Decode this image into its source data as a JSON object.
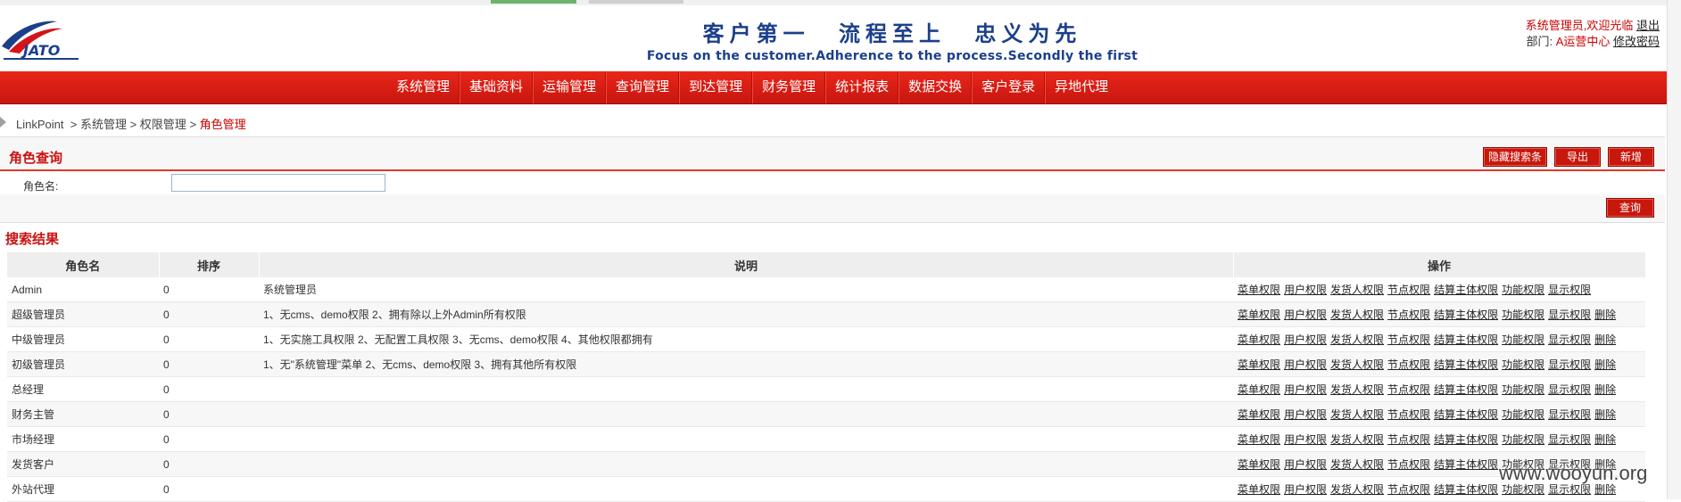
{
  "header": {
    "logo_text": "JATO",
    "slogan_cn": "客户第一   流程至上   忠义为先",
    "slogan_en": "Focus on the customer.Adherence to the process.Secondly the first",
    "user_welcome": "系统管理员,欢迎光临",
    "logout_label": "退出",
    "dept_label": "部门:",
    "dept_value": "A运营中心",
    "change_password_label": "修改密码"
  },
  "nav": {
    "items": [
      "系统管理",
      "基础资料",
      "运输管理",
      "查询管理",
      "到达管理",
      "财务管理",
      "统计报表",
      "数据交换",
      "客户登录",
      "异地代理"
    ]
  },
  "breadcrumb": {
    "root": "LinkPoint",
    "sep": ">",
    "level1": "系统管理",
    "level2": "权限管理",
    "current": "角色管理"
  },
  "search_panel": {
    "title": "角色查询",
    "hide_search_label": "隐藏搜索条",
    "export_label": "导出",
    "add_label": "新增",
    "role_name_label": "角色名:",
    "role_name_value": "",
    "query_label": "查询"
  },
  "results": {
    "title": "搜索结果",
    "columns": [
      "角色名",
      "排序",
      "说明",
      "操作"
    ],
    "op_labels": [
      "菜单权限",
      "用户权限",
      "发货人权限",
      "节点权限",
      "结算主体权限",
      "功能权限",
      "显示权限"
    ],
    "delete_label": "删除",
    "rows": [
      {
        "name": "Admin",
        "order": "0",
        "desc": "系统管理员",
        "deletable": false
      },
      {
        "name": "超级管理员",
        "order": "0",
        "desc": "1、无cms、demo权限 2、拥有除以上外Admin所有权限",
        "deletable": true
      },
      {
        "name": "中级管理员",
        "order": "0",
        "desc": "1、无实施工具权限 2、无配置工具权限 3、无cms、demo权限 4、其他权限都拥有",
        "deletable": true
      },
      {
        "name": "初级管理员",
        "order": "0",
        "desc": "1、无\"系统管理\"菜单 2、无cms、demo权限 3、拥有其他所有权限",
        "deletable": true
      },
      {
        "name": "总经理",
        "order": "0",
        "desc": "",
        "deletable": true
      },
      {
        "name": "财务主管",
        "order": "0",
        "desc": "",
        "deletable": true
      },
      {
        "name": "市场经理",
        "order": "0",
        "desc": "",
        "deletable": true
      },
      {
        "name": "发货客户",
        "order": "0",
        "desc": "",
        "deletable": true
      },
      {
        "name": "外站代理",
        "order": "0",
        "desc": "",
        "deletable": true
      }
    ]
  },
  "watermark": "www.wooyun.org",
  "colors": {
    "brand_red": "#c8170c",
    "title_red": "#cc1111",
    "slogan_blue": "#1b3f8a"
  }
}
